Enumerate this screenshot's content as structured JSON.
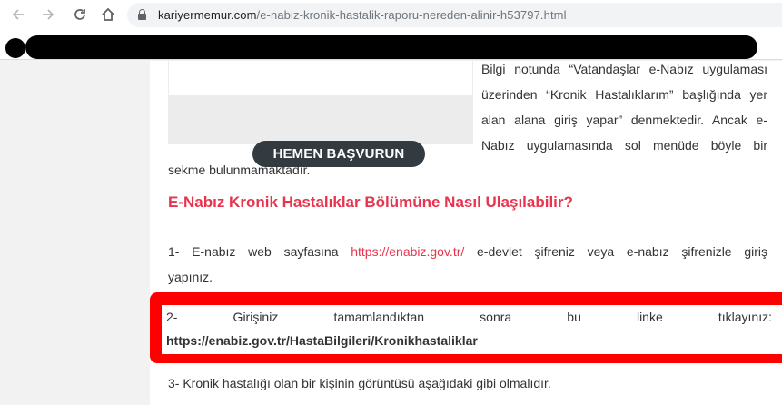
{
  "browser": {
    "url_host": "kariyermemur.com",
    "url_path": "/e-nabiz-kronik-hastalik-raporu-nereden-alinir-h53797.html",
    "icons": [
      "back-arrow-icon",
      "forward-arrow-icon",
      "reload-icon",
      "home-icon",
      "lock-icon"
    ]
  },
  "ad": {
    "button_label": "HEMEN BAŞVURUN"
  },
  "article": {
    "intro_lines": [
      "Bilgi notunda “Vatandaşlar e-Nabız uygulaması",
      "üzerinden “Kronik Hastalıklarım” başlığında yer",
      "alan alana giriş yapar” denmektedir. Ancak e-",
      "Nabız uygulamasında sol menüde böyle bir"
    ],
    "intro_continuation": "sekme bulunmamaktadır.",
    "heading": "E-Nabız Kronik Hastalıklar Bölümüne Nasıl Ulaşılabilir?",
    "step1_prefix": "1- E-nabız web sayfasına ",
    "step1_link": "https://enabiz.gov.tr/",
    "step1_suffix": " e-devlet şifreniz veya e-nabız şifrenizle giriş",
    "step1_line2": "yapınız.",
    "step2_line1": "2- Girişiniz tamamlandıktan sonra bu linke tıklayınız:",
    "step2_link": "https://enabiz.gov.tr/HastaBilgileri/Kronikhastaliklar",
    "step3": "3- Kronik hastalığı olan bir kişinin görüntüsü aşağıdaki gibi olmalıdır."
  },
  "colors": {
    "accent": "#e8344e",
    "highlight": "#ff0000",
    "button_bg": "#333b40"
  }
}
